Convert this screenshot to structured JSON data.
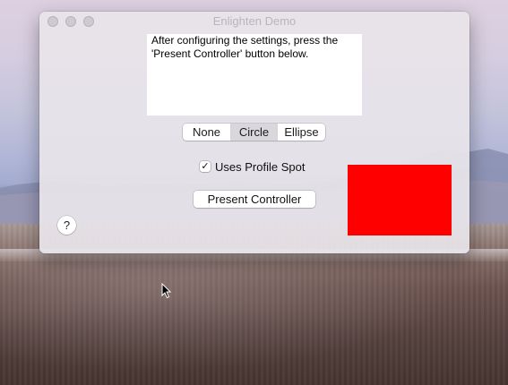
{
  "window": {
    "title": "Enlighten Demo"
  },
  "instructions": {
    "text": "After configuring the settings, press the\n'Present Controller' button below."
  },
  "shape_selector": {
    "segments": [
      {
        "label": "None",
        "selected": false
      },
      {
        "label": "Circle",
        "selected": true
      },
      {
        "label": "Ellipse",
        "selected": false
      }
    ]
  },
  "profile_spot": {
    "label": "Uses Profile Spot",
    "checked": true,
    "check_glyph": "✓"
  },
  "present_button": {
    "label": "Present Controller"
  },
  "help_button": {
    "label": "?"
  },
  "color_well": {
    "color": "#ff0000"
  },
  "icons": {
    "traffic_lights": [
      "close-icon",
      "minimize-icon",
      "zoom-icon"
    ],
    "cursor": "arrow-cursor-icon"
  }
}
